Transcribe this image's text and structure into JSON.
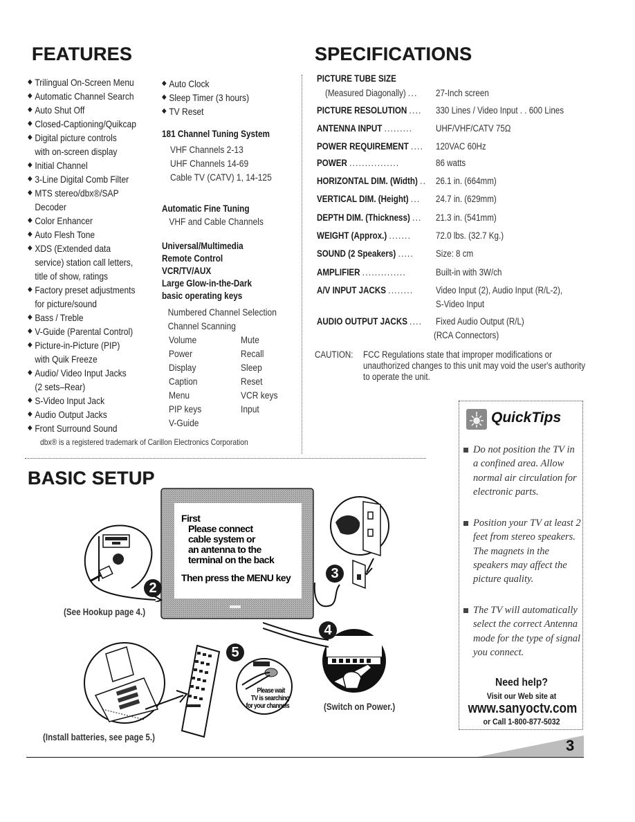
{
  "features": {
    "heading": "FEATURES",
    "column1": [
      {
        "text": "Trilingual On-Screen Menu"
      },
      {
        "text": "Automatic Channel Search"
      },
      {
        "text": "Auto Shut Off"
      },
      {
        "text": "Closed-Captioning/Quikcap"
      },
      {
        "text": "Digital picture controls",
        "cont": "with on-screen display"
      },
      {
        "text": "Initial Channel"
      },
      {
        "text": "3-Line Digital Comb Filter"
      },
      {
        "text": "MTS stereo/dbx®/SAP",
        "cont": "Decoder"
      },
      {
        "text": "Color Enhancer"
      },
      {
        "text": "Auto Flesh Tone"
      },
      {
        "text": "XDS (Extended data",
        "cont": "service) station call letters,",
        "cont2": "title of show, ratings"
      },
      {
        "text": "Factory preset adjustments",
        "cont": "for picture/sound"
      },
      {
        "text": "Bass / Treble"
      },
      {
        "text": "V-Guide (Parental Control)"
      },
      {
        "text": "Picture-in-Picture (PIP)",
        "cont": "with Quik Freeze"
      },
      {
        "text": "Audio/ Video Input Jacks",
        "cont": "(2 sets–Rear)"
      },
      {
        "text": "S-Video Input Jack"
      },
      {
        "text": "Audio Output Jacks"
      },
      {
        "text": "Front Surround Sound"
      }
    ],
    "column2": [
      {
        "text": "Auto Clock"
      },
      {
        "text": "Sleep Timer (3 hours)"
      },
      {
        "text": "TV Reset"
      }
    ],
    "tuning": {
      "title": "181 Channel Tuning System",
      "items": [
        "VHF Channels 2-13",
        "UHF Channels 14-69",
        "Cable TV (CATV) 1, 14-125"
      ]
    },
    "fine_tuning": {
      "title": "Automatic Fine Tuning",
      "items": [
        "VHF and Cable Channels"
      ]
    },
    "remote": {
      "title_lines": [
        "Universal/Multimedia",
        "Remote Control",
        "VCR/TV/AUX",
        "Large Glow-in-the-Dark",
        "basic operating keys"
      ],
      "full_items": [
        "Numbered Channel Selection",
        "Channel Scanning"
      ],
      "grid": [
        [
          "Volume",
          "Mute"
        ],
        [
          "Power",
          "Recall"
        ],
        [
          "Display",
          "Sleep"
        ],
        [
          "Caption",
          "Reset"
        ],
        [
          "Menu",
          "VCR keys"
        ],
        [
          "PIP keys",
          "Input"
        ],
        [
          "V-Guide",
          ""
        ]
      ]
    },
    "trademark_note": "dbx® is a registered trademark of Carillon Electronics Corporation",
    "bullet_icon": "diamond-bullet"
  },
  "specifications": {
    "heading": "SPECIFICATIONS",
    "picture_tube": {
      "label": "PICTURE TUBE SIZE",
      "sub_label": "(Measured Diagonally)",
      "dots": "...",
      "value": "27-Inch screen"
    },
    "rows": [
      {
        "label": "PICTURE RESOLUTION",
        "dots": "....",
        "value": "330 Lines / Video Input . . 600 Lines"
      },
      {
        "label": "ANTENNA INPUT",
        "dots": ".........",
        "value": "UHF/VHF/CATV 75Ω"
      },
      {
        "label": "POWER REQUIREMENT",
        "dots": "....",
        "value": "120VAC 60Hz"
      },
      {
        "label": "POWER",
        "dots": "................",
        "value": "86 watts"
      },
      {
        "label": "HORIZONTAL DIM. (Width)",
        "dots": "..",
        "value": "26.1 in. (664mm)"
      },
      {
        "label": "VERTICAL DIM. (Height)",
        "dots": "...",
        "value": "24.7 in. (629mm)"
      },
      {
        "label": "DEPTH DIM. (Thickness)",
        "dots": "...",
        "value": "21.3 in. (541mm)"
      },
      {
        "label": "WEIGHT (Approx.)",
        "dots": ".......",
        "value": "72.0 lbs. (32.7 Kg.)"
      },
      {
        "label": "SOUND (2 Speakers)",
        "dots": ".....",
        "value": "Size: 8 cm"
      },
      {
        "label": "AMPLIFIER",
        "dots": "..............",
        "value": "Built-in with 3W/ch"
      },
      {
        "label": "A/V INPUT JACKS",
        "dots": "........",
        "value": "Video Input (2), Audio Input (R/L-2),",
        "value2": "S-Video Input"
      },
      {
        "label": "AUDIO OUTPUT JACKS",
        "dots": "....",
        "value": "Fixed Audio Output (R/L)",
        "value2": "(RCA Connectors)"
      }
    ],
    "caution": {
      "label": "CAUTION:",
      "text": "FCC Regulations state that improper modifications or unauthorized changes to this unit may void the user's authority to operate the unit."
    }
  },
  "quicktips": {
    "title": "QuickTips",
    "icon": "lightbulb-icon",
    "tips": [
      "Do not position the TV in a confined area. Allow normal air circulation for electronic parts.",
      "Position your TV at least 2 feet from stereo speakers. The magnets in the speakers may affect the picture quality.",
      "The TV will automatically select the correct Antenna mode for the type of signal you connect."
    ],
    "help": {
      "title": "Need help?",
      "line1": "Visit our Web site at",
      "url": "www.sanyoctv.com",
      "phone": "or Call 1-800-877-5032"
    }
  },
  "basic_setup": {
    "heading": "BASIC SETUP",
    "tv_screen": {
      "line1": "First",
      "line2": "Please connect",
      "line3": "cable system or",
      "line4": "an antenna to the",
      "line5": "terminal on the back",
      "line6": "Then press the MENU key"
    },
    "remote_screen": {
      "key": "MENU",
      "line1": "Please wait",
      "line2": "TV is searching",
      "line3": "for your channels"
    },
    "steps": [
      "2",
      "3",
      "4",
      "5"
    ],
    "captions": {
      "hookup": "(See Hookup page 4.)",
      "power": "(Switch on Power.)",
      "batteries": "(Install batteries, see page 5.)"
    }
  },
  "page_number": "3",
  "colors": {
    "text": "#1a1a1a",
    "screen_gray": "#a8a8a8",
    "page_tab": "#bdbdbd"
  }
}
